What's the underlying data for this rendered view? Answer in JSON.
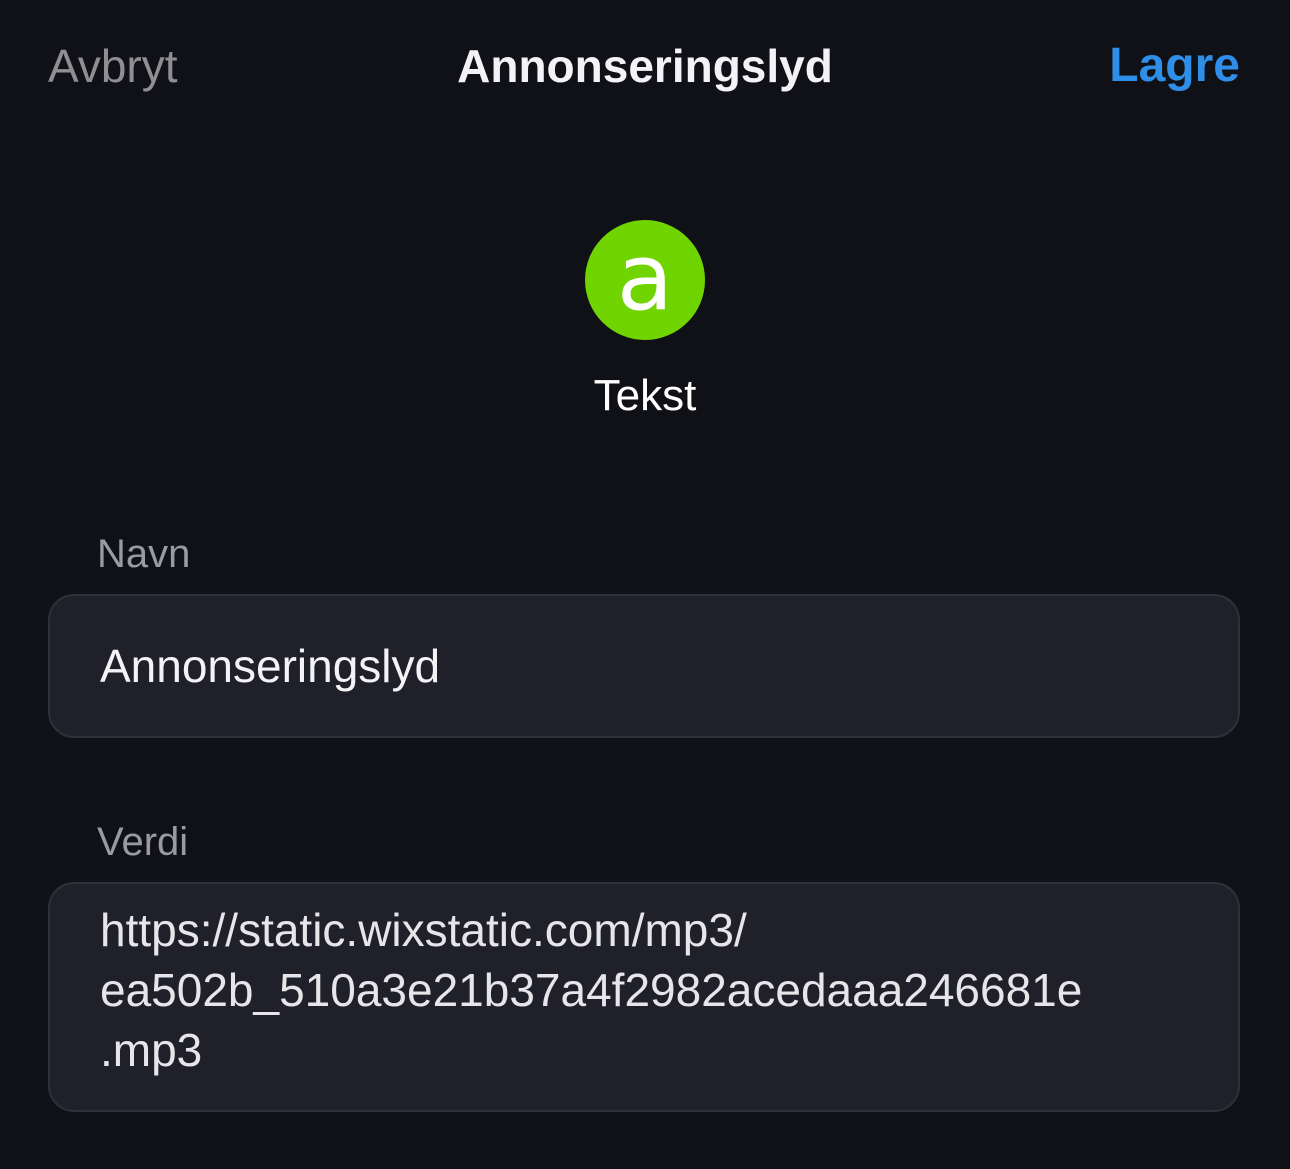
{
  "header": {
    "cancel_label": "Avbryt",
    "title": "Annonseringslyd",
    "save_label": "Lagre"
  },
  "type": {
    "icon_name": "letter-a-icon",
    "icon_glyph": "a",
    "icon_color": "#6fd400",
    "label": "Tekst"
  },
  "fields": {
    "name": {
      "label": "Navn",
      "value": "Annonseringslyd"
    },
    "value": {
      "label": "Verdi",
      "value": "https://static.wixstatic.com/mp3/\nea502b_510a3e21b37a4f2982acedaaa246681e\n.mp3"
    }
  },
  "colors": {
    "background": "#101116",
    "accent": "#2f8fe8",
    "field_background": "#1f2029"
  }
}
